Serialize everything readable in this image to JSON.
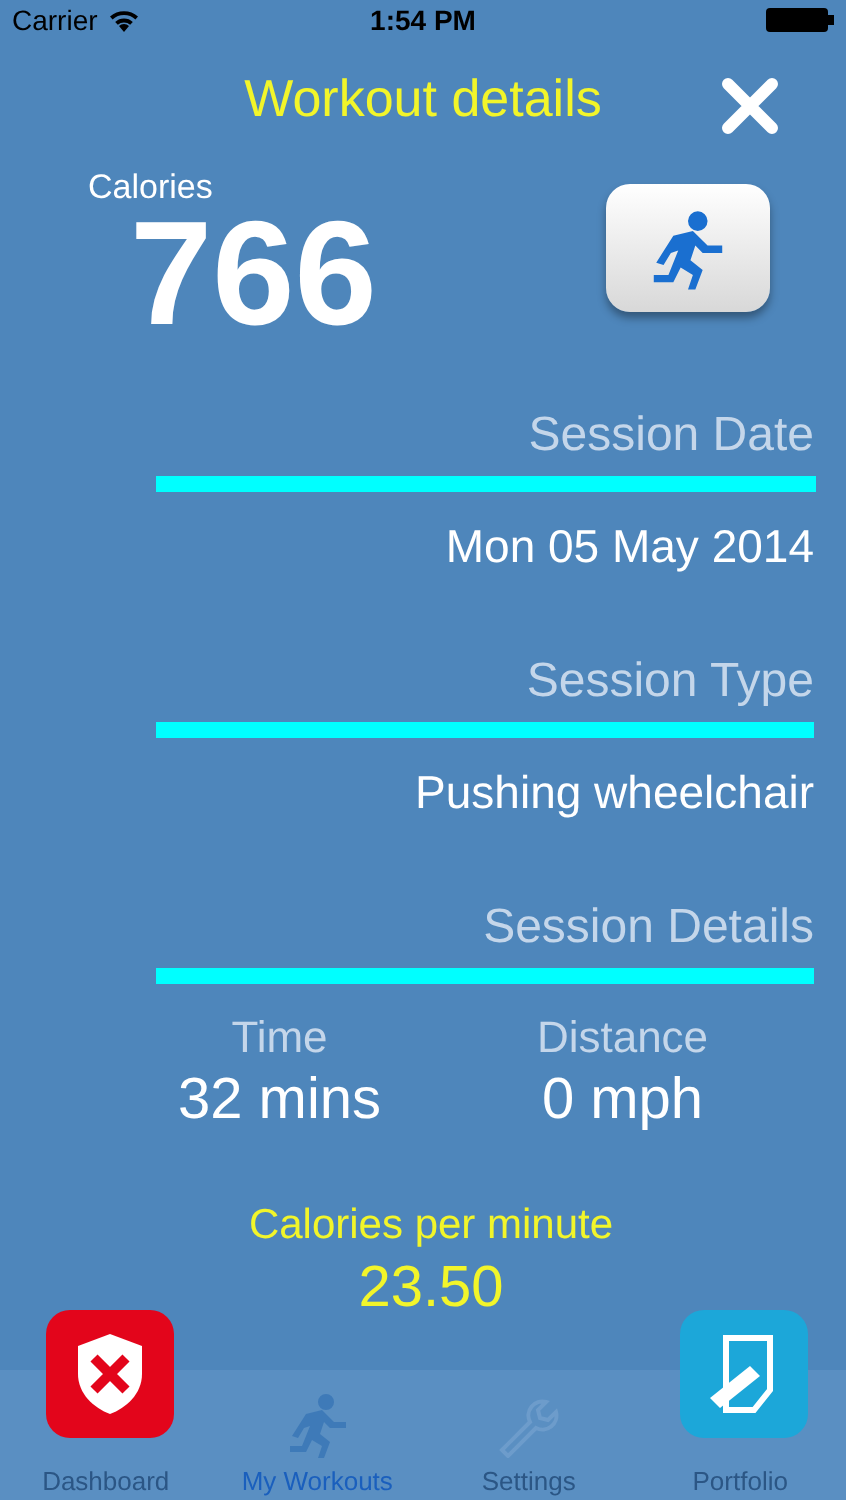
{
  "status_bar": {
    "carrier": "Carrier",
    "time": "1:54 PM"
  },
  "header": {
    "title": "Workout details"
  },
  "calories": {
    "label": "Calories",
    "value": "766"
  },
  "sections": [
    {
      "label": "Session Date",
      "value": "Mon 05 May 2014"
    },
    {
      "label": "Session Type",
      "value": "Pushing wheelchair"
    },
    {
      "label": "Session Details"
    }
  ],
  "stats": [
    {
      "label": "Time",
      "value": "32 mins"
    },
    {
      "label": "Distance",
      "value": "0 mph"
    }
  ],
  "rate": {
    "label": "Calories per minute",
    "value": "23.50"
  },
  "tab_bar": [
    {
      "label": "Dashboard",
      "selected": false
    },
    {
      "label": "My Workouts",
      "selected": true
    },
    {
      "label": "Settings",
      "selected": false
    },
    {
      "label": "Portfolio",
      "selected": false
    }
  ]
}
